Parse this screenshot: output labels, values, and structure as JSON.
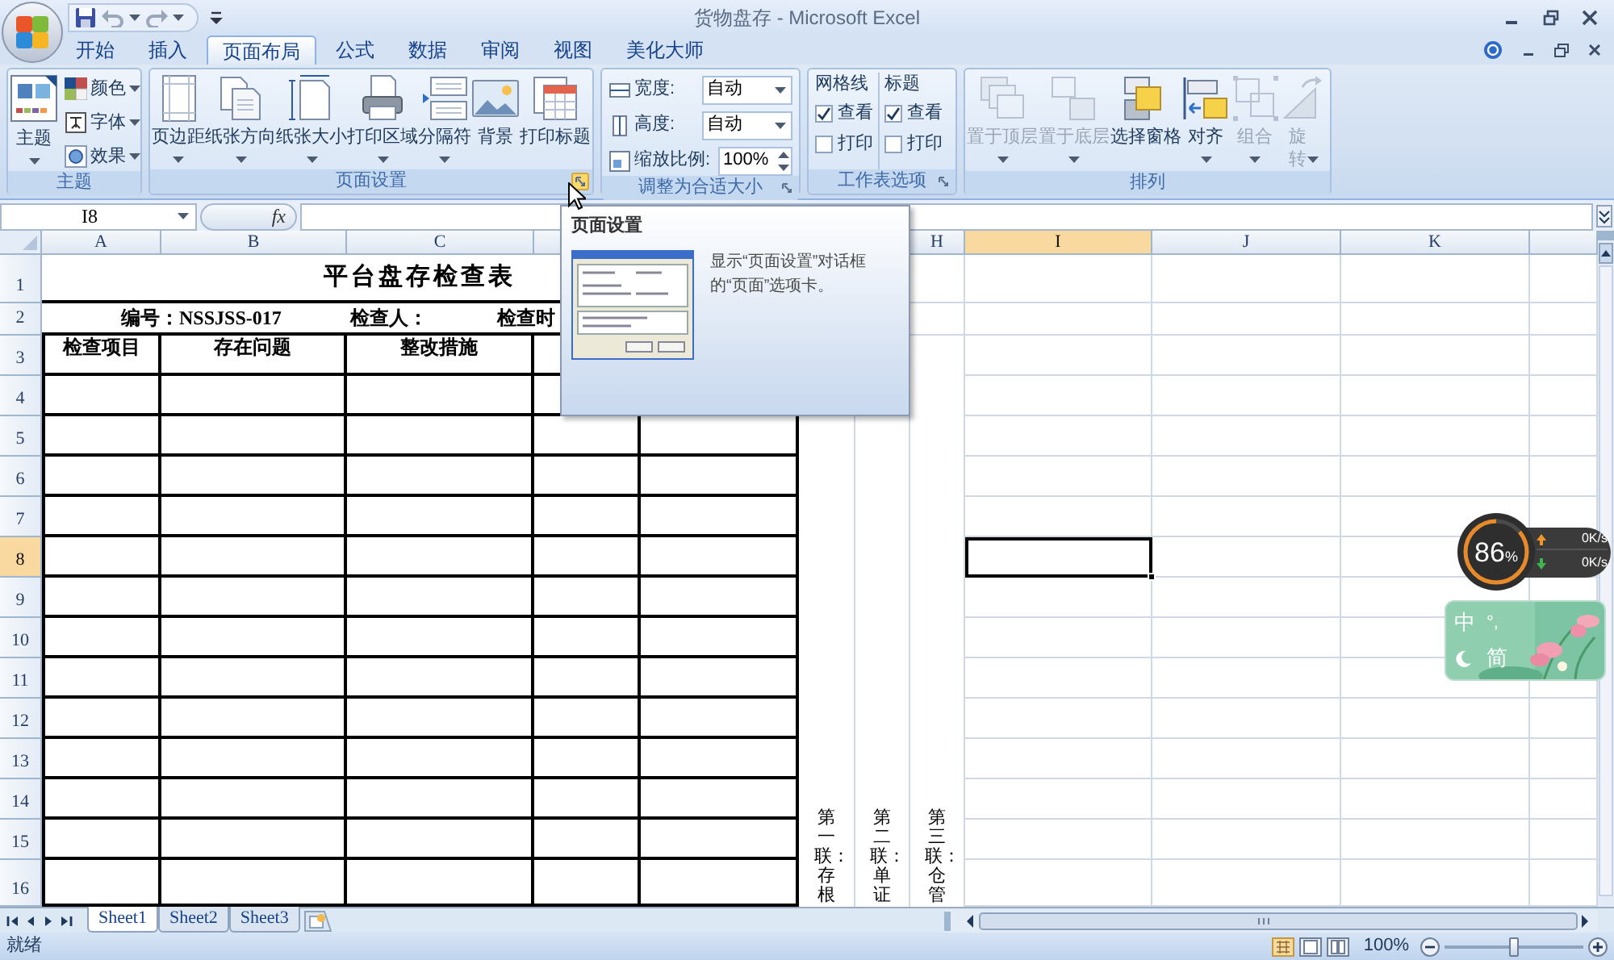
{
  "window": {
    "title": "货物盘存 - Microsoft Excel"
  },
  "tabs": [
    {
      "label": "开始",
      "selected": false
    },
    {
      "label": "插入",
      "selected": false
    },
    {
      "label": "页面布局",
      "selected": true
    },
    {
      "label": "公式",
      "selected": false
    },
    {
      "label": "数据",
      "selected": false
    },
    {
      "label": "审阅",
      "selected": false
    },
    {
      "label": "视图",
      "selected": false
    },
    {
      "label": "美化大师",
      "selected": false
    }
  ],
  "ribbon": {
    "theme_group": {
      "title": "主题",
      "main_button": "主题",
      "items": [
        {
          "label": "颜色"
        },
        {
          "label": "字体"
        },
        {
          "label": "效果"
        }
      ]
    },
    "page_setup_group": {
      "title": "页面设置",
      "launcher": {
        "highlighted": true
      },
      "buttons": [
        {
          "label": "页边距",
          "dropdown": true
        },
        {
          "label": "纸张方向",
          "dropdown": true
        },
        {
          "label": "纸张大小",
          "dropdown": true
        },
        {
          "label": "打印区域",
          "dropdown": true
        },
        {
          "label": "分隔符",
          "dropdown": true
        },
        {
          "label": "背景",
          "dropdown": false
        },
        {
          "label": "打印标题",
          "dropdown": false
        }
      ]
    },
    "scale_group": {
      "title": "调整为合适大小",
      "launcher": {
        "highlighted": false
      },
      "fields": [
        {
          "kind": "select",
          "label": "宽度:",
          "value": "自动"
        },
        {
          "kind": "select",
          "label": "高度:",
          "value": "自动"
        },
        {
          "kind": "spin",
          "label": "缩放比例:",
          "value": "100%"
        }
      ]
    },
    "sheet_options_group": {
      "title": "工作表选项",
      "launcher": {
        "highlighted": false
      },
      "columns": [
        {
          "heading": "网格线",
          "options": [
            {
              "label": "查看",
              "checked": true
            },
            {
              "label": "打印",
              "checked": false
            }
          ]
        },
        {
          "heading": "标题",
          "options": [
            {
              "label": "查看",
              "checked": true
            },
            {
              "label": "打印",
              "checked": false
            }
          ]
        }
      ]
    },
    "arrange_group": {
      "title": "排列",
      "buttons": [
        {
          "label": "置于顶层",
          "dropdown": true,
          "disabled": true
        },
        {
          "label": "置于底层",
          "dropdown": true,
          "disabled": true
        },
        {
          "label": "选择窗格",
          "dropdown": false,
          "disabled": false
        },
        {
          "label": "对齐",
          "dropdown": true,
          "disabled": false
        },
        {
          "label": "组合",
          "dropdown": true,
          "disabled": true
        },
        {
          "label": "旋转",
          "dropdown": true,
          "disabled": true
        }
      ]
    }
  },
  "formula_bar": {
    "name_box": "I8",
    "function_button": "fx"
  },
  "sheet": {
    "columns": [
      {
        "label": "A",
        "selected": false
      },
      {
        "label": "B",
        "selected": false
      },
      {
        "label": "C",
        "selected": false
      },
      {
        "selected": false
      },
      {
        "label": "H",
        "selected": false
      },
      {
        "label": "I",
        "selected": true
      },
      {
        "label": "J",
        "selected": false
      },
      {
        "label": "K",
        "selected": false
      },
      {
        "selected": false
      }
    ],
    "rows": [
      {
        "label": "1",
        "selected": false
      },
      {
        "label": "2",
        "selected": false
      },
      {
        "label": "3",
        "selected": false
      },
      {
        "label": "4",
        "selected": false
      },
      {
        "label": "5",
        "selected": false
      },
      {
        "label": "6",
        "selected": false
      },
      {
        "label": "7",
        "selected": false
      },
      {
        "label": "8",
        "selected": true
      },
      {
        "label": "9",
        "selected": false
      },
      {
        "label": "10",
        "selected": false
      },
      {
        "label": "11",
        "selected": false
      },
      {
        "label": "12",
        "selected": false
      },
      {
        "label": "13",
        "selected": false
      },
      {
        "label": "14",
        "selected": false
      },
      {
        "label": "15",
        "selected": false
      },
      {
        "label": "16",
        "selected": false
      }
    ],
    "title": "平台盘存检查表",
    "info_line": [
      "编号：NSSJSS-017",
      "检查人：",
      "检查时"
    ],
    "headers": [
      "检查项目",
      "存在问题",
      "整改措施"
    ],
    "copy_notes": [
      "第一联：存根",
      "第二联：单证",
      "第三联：仓管"
    ]
  },
  "tooltip": {
    "title": "页面设置",
    "description": "显示“页面设置”对话框的“页面”选项卡。"
  },
  "sheet_tabs": [
    {
      "label": "Sheet1",
      "selected": true
    },
    {
      "label": "Sheet2",
      "selected": false
    },
    {
      "label": "Sheet3",
      "selected": false
    }
  ],
  "status_bar": {
    "status": "就绪",
    "zoom": "100%",
    "zoom_slider": {
      "level": 0.5
    }
  },
  "speed_meter": {
    "value": "86",
    "unit": "%",
    "level": 0.86,
    "upload": "0K/s",
    "download": "0K/s"
  },
  "input_method": {
    "language": "中",
    "punctuation": "°,",
    "script": "简"
  }
}
